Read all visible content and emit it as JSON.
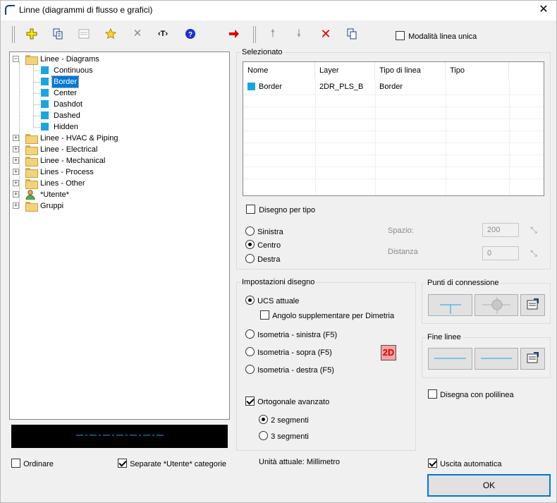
{
  "window": {
    "title": "Linne (diagrammi di flusso e grafici)"
  },
  "toolbar": {
    "single_line_mode_label": "Modalità linea unica",
    "single_line_mode_checked": false
  },
  "tree": {
    "groups": [
      {
        "label": "Linee - Diagrams",
        "expanded": true,
        "children": [
          "Continuous",
          "Border",
          "Center",
          "Dashdot",
          "Dashed",
          "Hidden"
        ],
        "selected": "Border"
      },
      {
        "label": "Linee - HVAC & Piping"
      },
      {
        "label": "Linee - Electrical"
      },
      {
        "label": "Linee - Mechanical"
      },
      {
        "label": "Lines - Process"
      },
      {
        "label": "Lines - Other"
      },
      {
        "label": "*Utente*"
      },
      {
        "label": "Gruppi"
      }
    ],
    "item_color": "#1aa5e0"
  },
  "selected": {
    "title": "Selezionato",
    "columns": [
      "Nome",
      "Layer",
      "Tipo di linea",
      "Tipo"
    ],
    "rows": [
      {
        "name": "Border",
        "layer": "2DR_PLS_B",
        "linetype": "Border",
        "type": ""
      }
    ],
    "draw_by_type_label": "Disegno per tipo",
    "draw_by_type_checked": false,
    "align_left": "Sinistra",
    "align_center": "Centro",
    "align_right": "Destra",
    "align_selected": "Centro",
    "spacing_label": "Spazio:",
    "spacing_value": "200",
    "distance_label": "Distanza",
    "distance_value": "0"
  },
  "drawing": {
    "title": "Impostazioni disegno",
    "ucs_label": "UCS attuale",
    "dimetria_label": "Angolo supplementare per Dimetria",
    "dimetria_checked": false,
    "iso_left": "Isometria - sinistra (F5)",
    "iso_top": "Isometria - sopra (F5)",
    "iso_right": "Isometria - destra (F5)",
    "mode_badge": "2D",
    "ortho_label": "Ortogonale avanzato",
    "ortho_checked": true,
    "seg2": "2 segmenti",
    "seg3": "3 segmenti"
  },
  "connections": {
    "title": "Punti di connessione"
  },
  "line_ends": {
    "title": "Fine linee"
  },
  "polyline": {
    "label": "Disegna con polilinea",
    "checked": false
  },
  "footer": {
    "sort_label": "Ordinare",
    "sort_checked": false,
    "separate_label": "Separate *Utente* categorie",
    "separate_checked": true,
    "units_text": "Unità attuale: Millimetro",
    "auto_exit_label": "Uscita automatica",
    "auto_exit_checked": true,
    "ok_label": "OK"
  }
}
